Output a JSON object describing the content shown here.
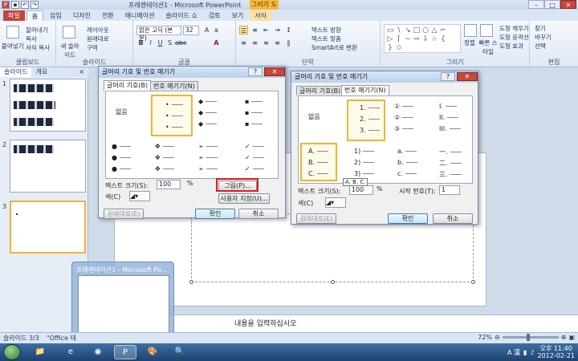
{
  "app": {
    "title": "프레젠테이션1 - Microsoft PowerPoint",
    "tool_tab": "그리기 도구"
  },
  "ribbon_tabs": [
    "파일",
    "홈",
    "삽입",
    "디자인",
    "전환",
    "애니메이션",
    "슬라이드 쇼",
    "검토",
    "보기",
    "서식"
  ],
  "ribbon": {
    "clipboard": {
      "paste": "붙여넣기",
      "cut": "잘라내기",
      "copy": "복사",
      "format_painter": "서식 복사",
      "label": "클립보드"
    },
    "slides": {
      "new_slide": "새 슬라이드",
      "layout": "레이아웃",
      "reset": "원래대로",
      "section": "구역",
      "label": "슬라이드"
    },
    "font": {
      "font_name": "맑은 고딕 (본문)",
      "font_size": "32",
      "label": "글꼴"
    },
    "paragraph": {
      "text_direction": "텍스트 방향",
      "align_text": "텍스트 맞춤",
      "smartart": "SmartArt로 변환",
      "label": "단락"
    },
    "drawing": {
      "arrange": "정렬",
      "quick_styles": "빠른 스타일",
      "shape_fill": "도형 채우기",
      "shape_outline": "도형 윤곽선",
      "shape_effects": "도형 효과",
      "label": "그리기"
    },
    "editing": {
      "find": "찾기",
      "replace": "바꾸기",
      "select": "선택",
      "label": "편집"
    }
  },
  "panel_tabs": [
    "슬라이드",
    "개요"
  ],
  "slides": [
    "1",
    "2",
    "3"
  ],
  "notes_placeholder": "내용을 입력하십시오",
  "status": {
    "slide_info": "슬라이드 3/3",
    "theme": "\"Office 테",
    "zoom": "72%"
  },
  "preview_title": "프레젠테이션1 - Microsoft Po...",
  "tray": {
    "lang": "A 漢",
    "time": "오후 11:40",
    "date": "2012-02-21"
  },
  "dialog1": {
    "title": "글머리 기호 및 번호 매기기",
    "tabs": [
      "글머리 기호(B)",
      "번호 매기기(N)"
    ],
    "none_label": "없음",
    "size_label": "텍스트 크기(S):",
    "size_value": "100",
    "percent": "%",
    "color_label": "색(C)",
    "picture_button": "그림(P)...",
    "customize_button": "사용자 지정(U)...",
    "reset_button": "원래대로(E)",
    "ok_button": "확인",
    "cancel_button": "취소"
  },
  "dialog2": {
    "title": "글머리 기호 및 번호 매기기",
    "tabs": [
      "글머리 기호(B)",
      "번호 매기기(N)"
    ],
    "none_label": "없음",
    "size_label": "텍스트 크기(S):",
    "size_value": "100",
    "percent": "%",
    "start_label": "시작 번호(T):",
    "start_value": "1",
    "color_label": "색(C)",
    "reset_button": "원래대로(E)",
    "ok_button": "확인",
    "cancel_button": "취소",
    "tooltip": "A. B. C.",
    "num": {
      "c1": [
        "1.",
        "2.",
        "3."
      ],
      "c2": [
        "①",
        "②",
        "③"
      ],
      "c3": [
        "I.",
        "II.",
        "III."
      ],
      "c4": [
        "A.",
        "B.",
        "C."
      ],
      "c5": [
        "1)",
        "2)",
        "3)"
      ],
      "c6": [
        "a.",
        "b.",
        "c."
      ],
      "c7": [
        "一.",
        "二.",
        "三."
      ]
    }
  }
}
